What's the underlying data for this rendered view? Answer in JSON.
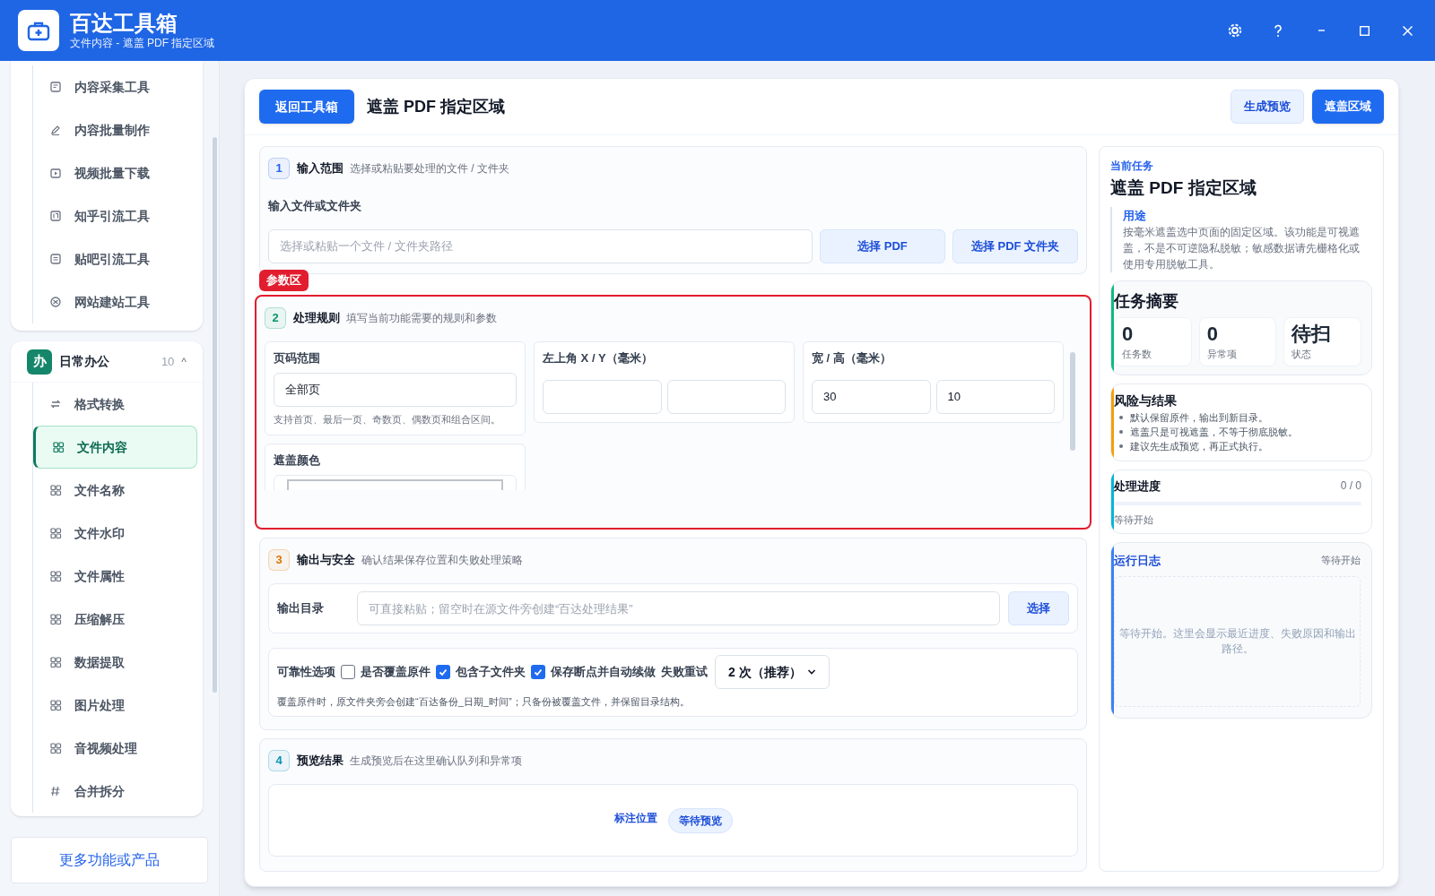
{
  "app": {
    "title": "百达工具箱",
    "subtitle": "文件内容 - 遮盖 PDF 指定区域"
  },
  "sidebar": {
    "groups": [
      {
        "items": [
          {
            "label": "内容采集工具",
            "kind": "doc",
            "selected": false
          },
          {
            "label": "内容批量制作",
            "kind": "pen",
            "selected": false
          },
          {
            "label": "视频批量下载",
            "kind": "video",
            "selected": false
          },
          {
            "label": "知乎引流工具",
            "kind": "zhi",
            "selected": false
          },
          {
            "label": "贴吧引流工具",
            "kind": "note",
            "selected": false
          },
          {
            "label": "网站建站工具",
            "kind": "globe",
            "selected": false
          }
        ]
      },
      {
        "badge": "办",
        "title": "日常办公",
        "count": "10",
        "caret": "^",
        "expanded": true,
        "items": [
          {
            "label": "格式转换",
            "kind": "swap",
            "selected": false
          },
          {
            "label": "文件内容",
            "kind": "grid",
            "selected": true
          },
          {
            "label": "文件名称",
            "kind": "grid",
            "selected": false
          },
          {
            "label": "文件水印",
            "kind": "grid",
            "selected": false
          },
          {
            "label": "文件属性",
            "kind": "grid",
            "selected": false
          },
          {
            "label": "压缩解压",
            "kind": "grid",
            "selected": false
          },
          {
            "label": "数据提取",
            "kind": "grid",
            "selected": false
          },
          {
            "label": "图片处理",
            "kind": "grid",
            "selected": false
          },
          {
            "label": "音视频处理",
            "kind": "grid",
            "selected": false
          },
          {
            "label": "合并拆分",
            "kind": "hash",
            "selected": false
          }
        ]
      }
    ],
    "more_button": "更多功能或产品"
  },
  "toolbar": {
    "back_button": "返回工具箱",
    "title": "遮盖 PDF 指定区域",
    "buttons": [
      {
        "label": "生成预览",
        "kind": "secondary"
      },
      {
        "label": "遮盖区域",
        "kind": "primary"
      }
    ]
  },
  "sections": [
    {
      "number": "1",
      "color": "#2563eb",
      "title": "输入范围",
      "hint": "选择或粘贴要处理的文件 / 文件夹",
      "kind": "input",
      "field_label": "输入文件或文件夹",
      "placeholder": "选择或粘贴一个文件 / 文件夹路径",
      "buttons": [
        "选择 PDF",
        "选择 PDF 文件夹"
      ]
    },
    {
      "number": "2",
      "color": "#059669",
      "title": "处理规则",
      "hint": "填写当前功能需要的规则和参数",
      "kind": "rules",
      "tag": "参数区",
      "fields": [
        {
          "label": "页码范围",
          "kind": "text",
          "value": "全部页",
          "note": "支持首页、最后一页、奇数页、偶数页和组合区间。"
        },
        {
          "label": "左上角 X / Y（毫米）",
          "kind": "pair"
        },
        {
          "label": "宽 / 高（毫米）",
          "kind": "pair",
          "values": [
            "30",
            "10"
          ]
        },
        {
          "label": "遮盖颜色",
          "kind": "color"
        }
      ]
    },
    {
      "number": "3",
      "color": "#d97706",
      "title": "输出与安全",
      "hint": "确认结果保存位置和失败处理策略",
      "kind": "output",
      "output_label": "输出目录",
      "placeholder": "可直接粘贴；留空时在源文件旁创建“百达处理结果”",
      "choose_button": "选择",
      "options_label": "可靠性选项",
      "options": [
        {
          "label": "是否覆盖原件",
          "checked": false
        },
        {
          "label": "包含子文件夹",
          "checked": true
        },
        {
          "label": "保存断点并自动续做",
          "checked": true
        }
      ],
      "retry_label": "失败重试",
      "retry_value": "2 次（推荐）",
      "note": "覆盖原件时，原文件夹旁会创建“百达备份_日期_时间”；只备份被覆盖文件，并保留目录结构。"
    },
    {
      "number": "4",
      "color": "#0891b2",
      "title": "预览结果",
      "hint": "生成预览后在这里确认队列和异常项",
      "kind": "preview",
      "link": "标注位置",
      "status": "等待预览"
    }
  ],
  "task_panel": {
    "eyebrow": "当前任务",
    "title": "遮盖 PDF 指定区域",
    "purpose_label": "用途",
    "purpose": "按毫米遮盖选中页面的固定区域。该功能是可视遮盖，不是不可逆隐私脱敏；敏感数据请先栅格化或使用专用脱敏工具。",
    "summary": {
      "title": "任务摘要",
      "color": "#10b981",
      "stats": [
        {
          "value": "0",
          "label": "任务数"
        },
        {
          "value": "0",
          "label": "异常项"
        },
        {
          "value": "待扫",
          "label": "状态"
        }
      ]
    },
    "risks": {
      "title": "风险与结果",
      "color": "#f59e0b",
      "items": [
        "默认保留原件，输出到新目录。",
        "遮盖只是可视遮盖，不等于彻底脱敏。",
        "建议先生成预览，再正式执行。"
      ]
    },
    "progress": {
      "title": "处理进度",
      "count": "0 / 0",
      "level": 0,
      "status": "等待开始",
      "color": "#06b6d4"
    },
    "log": {
      "title": "运行日志",
      "status": "等待开始",
      "empty": "等待开始。这里会显示最近进度、失败原因和输出路径。",
      "color": "#3b82f6"
    }
  }
}
